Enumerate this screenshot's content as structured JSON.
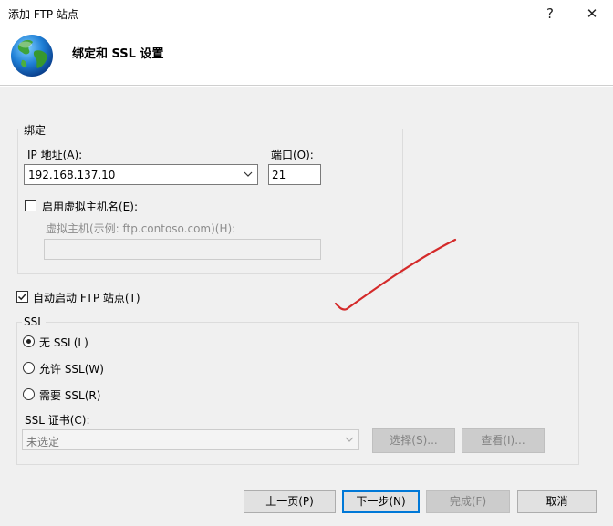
{
  "window": {
    "title": "添加 FTP 站点",
    "help_glyph": "?",
    "close_glyph": "✕"
  },
  "header": {
    "title": "绑定和 SSL 设置",
    "icon": "globe-icon"
  },
  "binding": {
    "legend": "绑定",
    "ip_label": "IP 地址(A):",
    "ip_value": "192.168.137.10",
    "port_label": "端口(O):",
    "port_value": "21",
    "virtual_host_checkbox_label": "启用虚拟主机名(E):",
    "virtual_host_checked": false,
    "virtual_host_field_label": "虚拟主机(示例: ftp.contoso.com)(H):",
    "virtual_host_value": ""
  },
  "autostart": {
    "label": "自动启动 FTP 站点(T)",
    "checked": true
  },
  "ssl": {
    "legend": "SSL",
    "options": [
      {
        "label": "无 SSL(L)",
        "selected": true
      },
      {
        "label": "允许 SSL(W)",
        "selected": false
      },
      {
        "label": "需要 SSL(R)",
        "selected": false
      }
    ],
    "cert_label": "SSL 证书(C):",
    "cert_value": "未选定",
    "select_button": "选择(S)...",
    "view_button": "查看(I)..."
  },
  "footer": {
    "prev": "上一页(P)",
    "next": "下一步(N)",
    "finish": "完成(F)",
    "cancel": "取消"
  },
  "colors": {
    "annotation_stroke": "#d42a2a",
    "default_button_border": "#0078d7",
    "panel_background": "#f0f0f0"
  }
}
